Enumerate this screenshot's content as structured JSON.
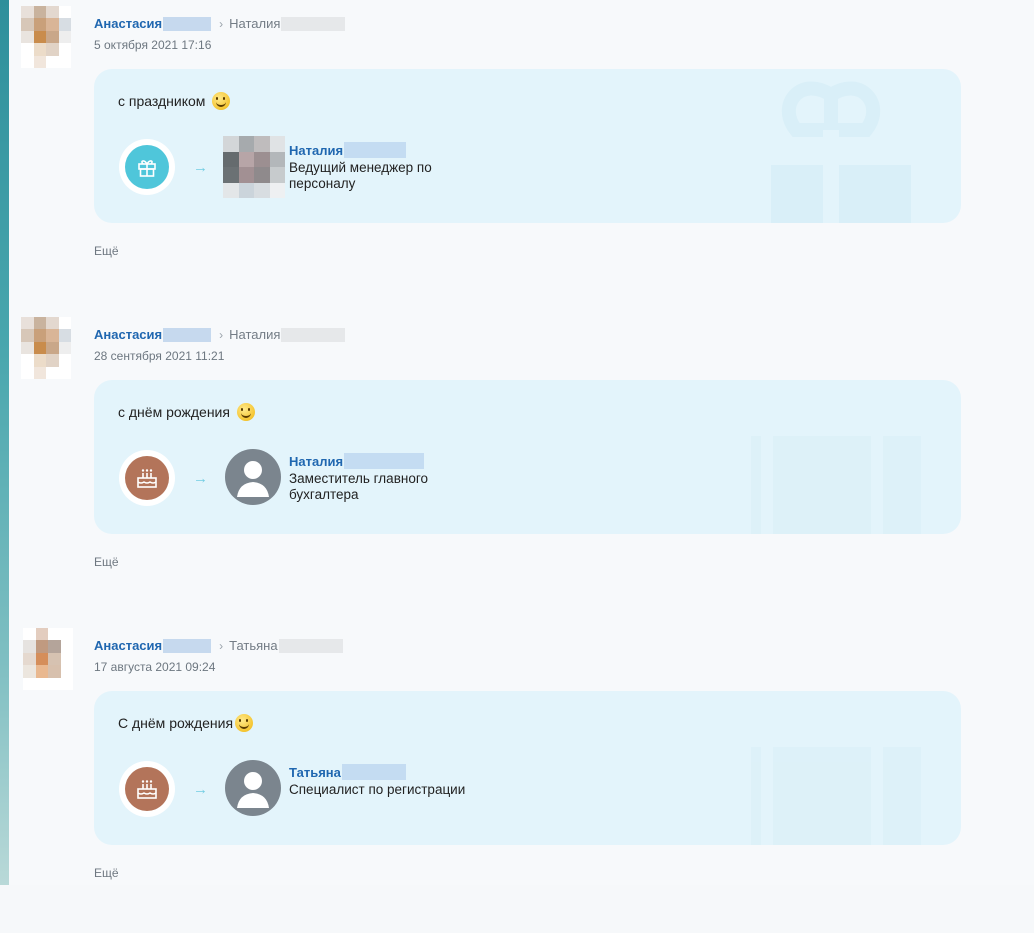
{
  "posts": [
    {
      "author": "Анастасия",
      "recipient": "Наталия",
      "date": "5 октября 2021 17:16",
      "message": "с праздником",
      "badge": "gift-icon",
      "badge_color": "#4fc6da",
      "person_name": "Наталия",
      "person_role": "Ведущий менеджер по персоналу",
      "more": "Ещё"
    },
    {
      "author": "Анастасия",
      "recipient": "Наталия",
      "date": "28 сентября 2021 11:21",
      "message": "с днём рождения",
      "badge": "birthday-cake-icon",
      "badge_color": "#b3745a",
      "person_name": "Наталия",
      "person_role": "Заместитель главного бухгалтера",
      "more": "Ещё"
    },
    {
      "author": "Анастасия",
      "recipient": "Татьяна",
      "date": "17 августа 2021 09:24",
      "message": "С днём рождения",
      "badge": "birthday-cake-icon",
      "badge_color": "#b3745a",
      "person_name": "Татьяна",
      "person_role": "Специалист по регистрации",
      "more": "Ещё"
    }
  ],
  "colors": {
    "link": "#2067b0",
    "card_bg": "#e3f4fb",
    "arrow": "#73cde3"
  }
}
